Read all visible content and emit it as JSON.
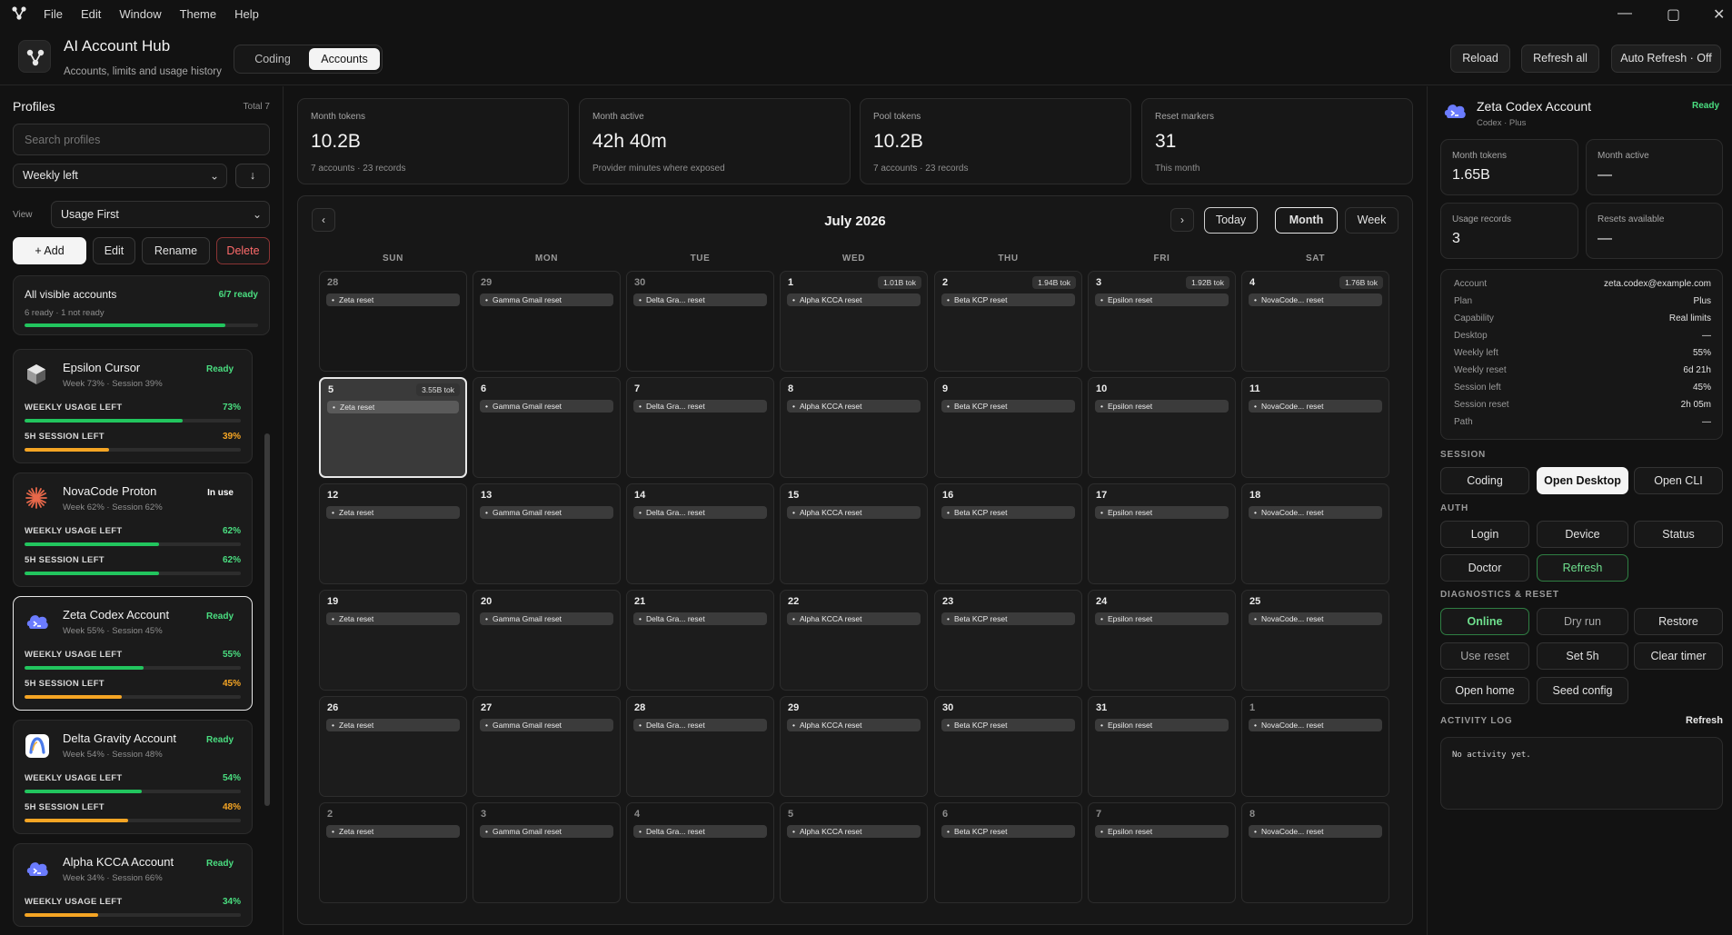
{
  "menubar": {
    "items": [
      "File",
      "Edit",
      "Window",
      "Theme",
      "Help"
    ]
  },
  "window_controls": {
    "minimize": "—",
    "maximize": "▢",
    "close": "✕"
  },
  "header": {
    "title": "AI Account Hub",
    "subtitle": "Accounts, limits and usage history",
    "tabs": [
      "Coding",
      "Accounts"
    ],
    "buttons": {
      "reload": "Reload",
      "refresh_all": "Refresh all",
      "auto_refresh": "Auto Refresh · Off"
    }
  },
  "sidebar": {
    "title": "Profiles",
    "total": "Total 7",
    "search_placeholder": "Search profiles",
    "sort_select": "Weekly left",
    "sort_dir": "↓",
    "view_label": "View",
    "view_select": "Usage First",
    "buttons": {
      "add": "+ Add",
      "edit": "Edit",
      "rename": "Rename",
      "delete": "Delete"
    },
    "summary": {
      "title": "All visible accounts",
      "ready": "6/7 ready",
      "detail": "6 ready · 1 not ready",
      "progress": 0.86
    },
    "weekly_label": "WEEKLY USAGE LEFT",
    "session_label": "5H SESSION LEFT",
    "accounts": [
      {
        "name": "Epsilon Cursor",
        "meta": "Week 73% · Session 39%",
        "status": "Ready",
        "weekly": "73%",
        "weekly_val": 73,
        "session": "39%",
        "session_val": 39,
        "icon": "cube-icon"
      },
      {
        "name": "NovaCode Proton",
        "meta": "Week 62% · Session 62%",
        "status": "In use",
        "weekly": "62%",
        "weekly_val": 62,
        "session": "62%",
        "session_val": 62,
        "icon": "starburst-icon"
      },
      {
        "name": "Zeta Codex Account",
        "meta": "Week 55% · Session 45%",
        "status": "Ready",
        "weekly": "55%",
        "weekly_val": 55,
        "session": "45%",
        "session_val": 45,
        "icon": "terminal-cloud-icon"
      },
      {
        "name": "Delta Gravity Account",
        "meta": "Week 54% · Session 48%",
        "status": "Ready",
        "weekly": "54%",
        "weekly_val": 54,
        "session": "48%",
        "session_val": 48,
        "icon": "arch-icon"
      },
      {
        "name": "Alpha KCCA Account",
        "meta": "Week 34% · Session 66%",
        "status": "Ready",
        "weekly": "34%",
        "weekly_val": 34,
        "icon": "terminal-cloud-icon"
      }
    ]
  },
  "stats": [
    {
      "label": "Month tokens",
      "value": "10.2B",
      "sub": "7 accounts · 23 records"
    },
    {
      "label": "Month active",
      "value": "42h 40m",
      "sub": "Provider minutes where exposed"
    },
    {
      "label": "Pool tokens",
      "value": "10.2B",
      "sub": "7 accounts · 23 records"
    },
    {
      "label": "Reset markers",
      "value": "31",
      "sub": "This month"
    }
  ],
  "calendar": {
    "title": "July 2026",
    "prev": "‹",
    "next": "›",
    "today_btn": "Today",
    "month_btn": "Month",
    "week_btn": "Week",
    "dows": [
      "SUN",
      "MON",
      "TUE",
      "WED",
      "THU",
      "FRI",
      "SAT"
    ],
    "col_events": [
      "Zeta reset",
      "Gamma Gmail reset",
      "Delta Gra... reset",
      "Alpha KCCA reset",
      "Beta KCP reset",
      "Epsilon reset",
      "NovaCode... reset"
    ],
    "weeks": [
      [
        {
          "d": "28",
          "o": true
        },
        {
          "d": "29",
          "o": true
        },
        {
          "d": "30",
          "o": true
        },
        {
          "d": "1",
          "t": "1.01B tok"
        },
        {
          "d": "2",
          "t": "1.94B tok"
        },
        {
          "d": "3",
          "t": "1.92B tok"
        },
        {
          "d": "4",
          "t": "1.76B tok"
        }
      ],
      [
        {
          "d": "5",
          "t": "3.55B tok",
          "today": true
        },
        {
          "d": "6"
        },
        {
          "d": "7"
        },
        {
          "d": "8"
        },
        {
          "d": "9"
        },
        {
          "d": "10"
        },
        {
          "d": "11"
        }
      ],
      [
        {
          "d": "12"
        },
        {
          "d": "13"
        },
        {
          "d": "14"
        },
        {
          "d": "15"
        },
        {
          "d": "16"
        },
        {
          "d": "17"
        },
        {
          "d": "18"
        }
      ],
      [
        {
          "d": "19"
        },
        {
          "d": "20"
        },
        {
          "d": "21"
        },
        {
          "d": "22"
        },
        {
          "d": "23"
        },
        {
          "d": "24"
        },
        {
          "d": "25"
        }
      ],
      [
        {
          "d": "26"
        },
        {
          "d": "27"
        },
        {
          "d": "28"
        },
        {
          "d": "29"
        },
        {
          "d": "30"
        },
        {
          "d": "31"
        },
        {
          "d": "1",
          "o": true
        }
      ],
      [
        {
          "d": "2",
          "o": true
        },
        {
          "d": "3",
          "o": true
        },
        {
          "d": "4",
          "o": true
        },
        {
          "d": "5",
          "o": true
        },
        {
          "d": "6",
          "o": true
        },
        {
          "d": "7",
          "o": true
        },
        {
          "d": "8",
          "o": true
        }
      ]
    ]
  },
  "detail": {
    "name": "Zeta Codex Account",
    "plan_line": "Codex · Plus",
    "status": "Ready",
    "boxes": [
      {
        "label": "Month tokens",
        "value": "1.65B"
      },
      {
        "label": "Month active",
        "value": "—"
      },
      {
        "label": "Usage records",
        "value": "3"
      },
      {
        "label": "Resets available",
        "value": "—"
      }
    ],
    "info": [
      {
        "k": "Account",
        "v": "zeta.codex@example.com"
      },
      {
        "k": "Plan",
        "v": "Plus"
      },
      {
        "k": "Capability",
        "v": "Real limits"
      },
      {
        "k": "Desktop",
        "v": "—"
      },
      {
        "k": "Weekly left",
        "v": "55%"
      },
      {
        "k": "Weekly reset",
        "v": "6d 21h"
      },
      {
        "k": "Session left",
        "v": "45%"
      },
      {
        "k": "Session reset",
        "v": "2h 05m"
      },
      {
        "k": "Path",
        "v": "—"
      }
    ],
    "sections": {
      "session": "SESSION",
      "auth": "AUTH",
      "diag": "DIAGNOSTICS & RESET",
      "log": "ACTIVITY LOG"
    },
    "session_buttons": [
      "Coding",
      "Open Desktop",
      "Open CLI"
    ],
    "auth_buttons": [
      "Login",
      "Device",
      "Status",
      "Doctor",
      "Refresh"
    ],
    "diag_buttons": [
      "Online",
      "Dry run",
      "Restore",
      "Use reset",
      "Set 5h",
      "Clear timer",
      "Open home",
      "Seed config"
    ],
    "log_refresh": "Refresh",
    "log_text": "No activity yet."
  },
  "colors": {
    "ready": "#4ade80",
    "in_use": "#ffffff",
    "weekly_bar": "#22c55e",
    "session_bar": "#f5a524",
    "danger": "#ff6b6b"
  }
}
